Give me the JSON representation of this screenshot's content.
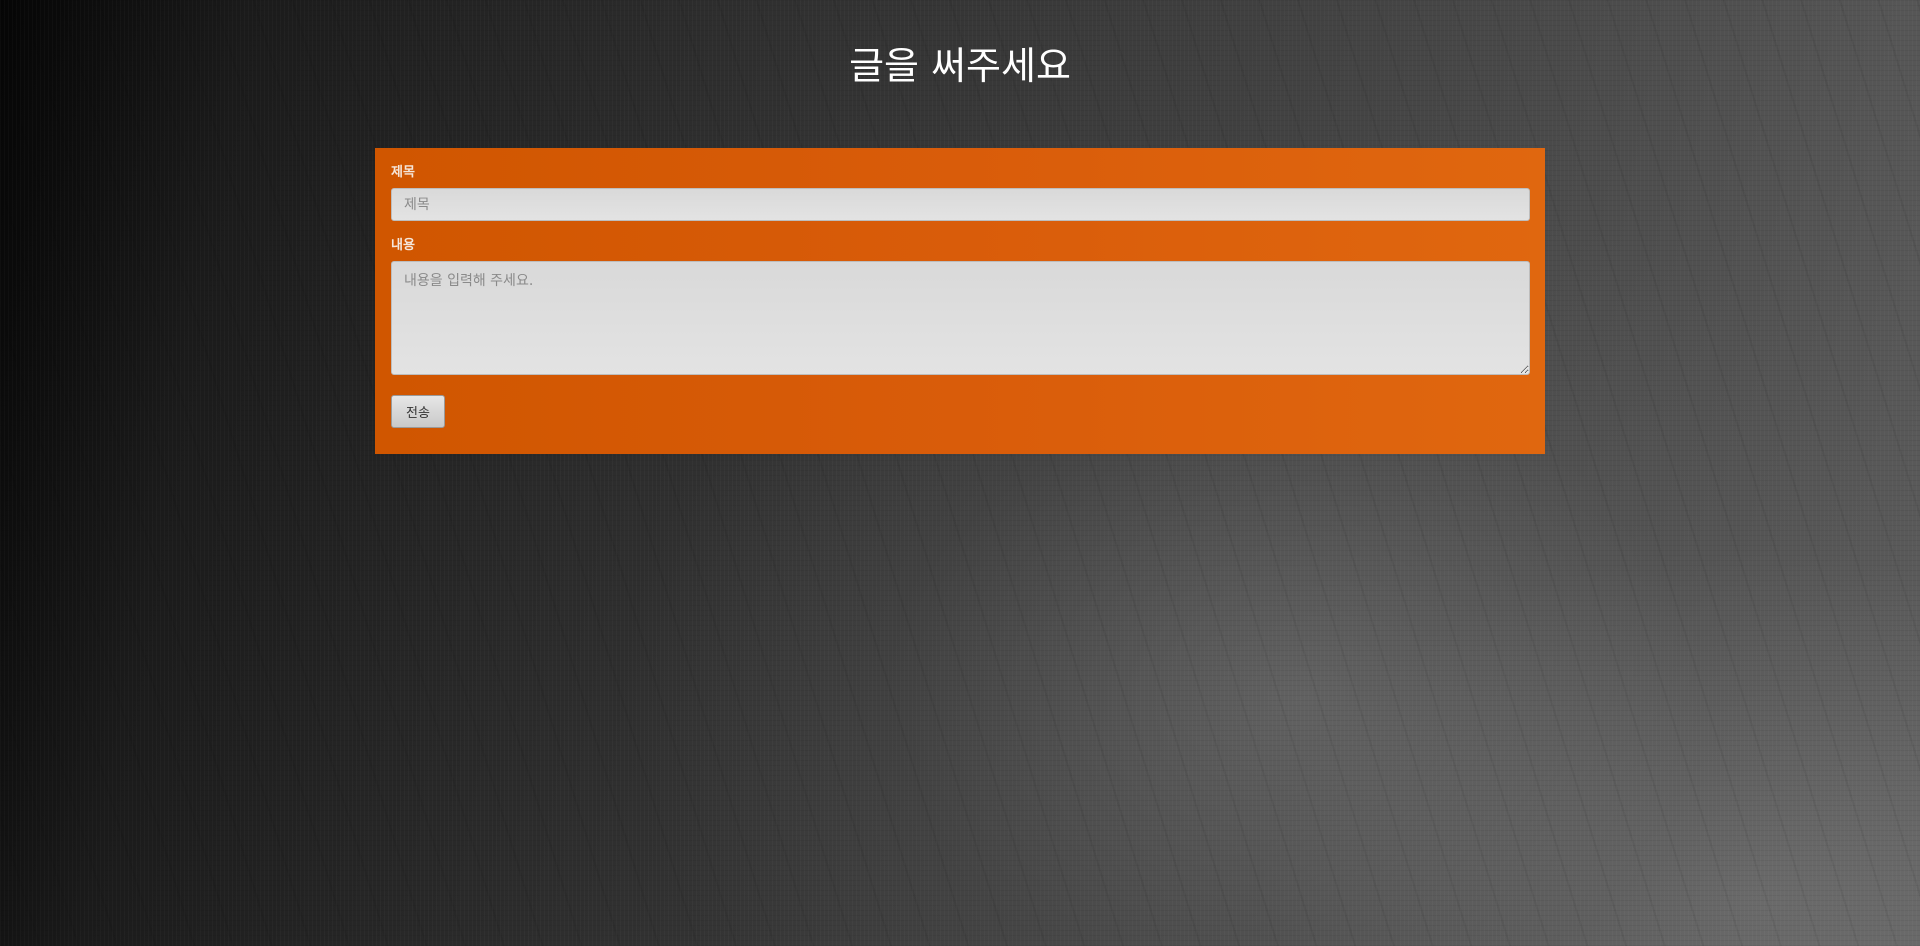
{
  "page": {
    "title": "글을 써주세요"
  },
  "form": {
    "title_label": "제목",
    "title_placeholder": "제목",
    "title_value": "",
    "content_label": "내용",
    "content_placeholder": "내용을 입력해 주세요.",
    "content_value": "",
    "submit_label": "전송"
  },
  "colors": {
    "panel_accent": "#d95c0a",
    "background_dark": "#2a2a2a",
    "title_text": "#ffffff"
  }
}
